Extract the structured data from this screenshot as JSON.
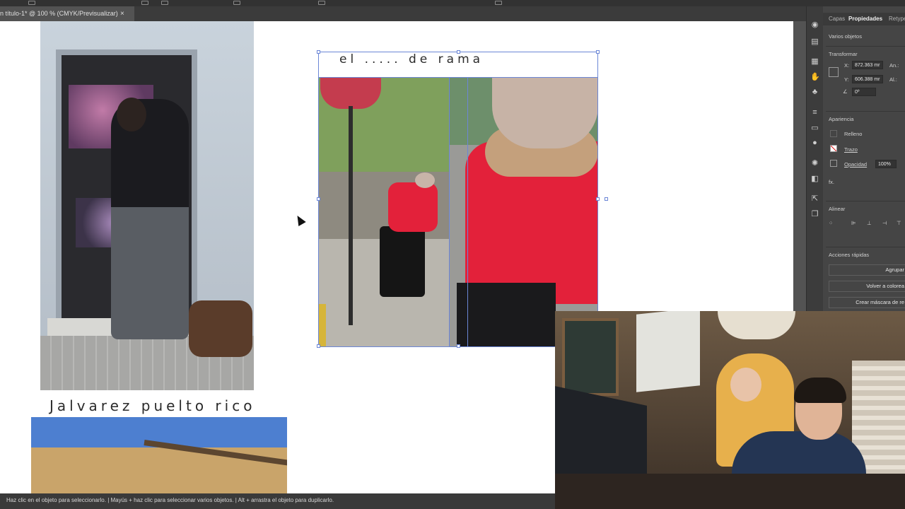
{
  "document_tab": {
    "title": "n título-1* @ 100 % (CMYK/Previsualizar)",
    "close_glyph": "×"
  },
  "canvas": {
    "text_frames": [
      {
        "text": "el ..... de rama"
      },
      {
        "text": "Jalvarez  puelto rico"
      }
    ]
  },
  "status_bar": {
    "hint": "Haz clic en el objeto para seleccionarlo.  |  Mayús + haz clic para seleccionar varios objetos.  |  Alt + arrastra el objeto para duplicarlo."
  },
  "properties_panel": {
    "tabs": [
      "Capas",
      "Propiedades",
      "Retype"
    ],
    "active_tab": "Propiedades",
    "selection_label": "Varios objetos",
    "transform": {
      "heading": "Transformar",
      "x_label": "X:",
      "x_value": "872.363 mr",
      "y_label": "Y:",
      "y_value": "606.388 mr",
      "w_label": "An.:",
      "h_label": "Al.:",
      "rotation_value": "0º"
    },
    "appearance": {
      "heading": "Apariencia",
      "fill_label": "Relleno",
      "stroke_label": "Trazo",
      "opacity_label": "Opacidad",
      "opacity_value": "100%",
      "fx_label": "fx."
    },
    "align": {
      "heading": "Alinear"
    },
    "quick_actions": {
      "heading": "Acciones rápidas",
      "buttons": [
        "Agrupar",
        "Volver a colorea",
        "Crear máscara de re"
      ]
    }
  },
  "colors": {
    "ui_dark": "#323232",
    "panel": "#454545",
    "selection": "#6b86d6",
    "canvas": "#ffffff"
  },
  "icons": [
    "eye-icon",
    "layers-icon",
    "grid-icon",
    "puppet-icon",
    "club-icon",
    "menu-icon",
    "gradient-icon",
    "sphere-icon",
    "sun-icon",
    "export-icon",
    "stack-icon"
  ]
}
